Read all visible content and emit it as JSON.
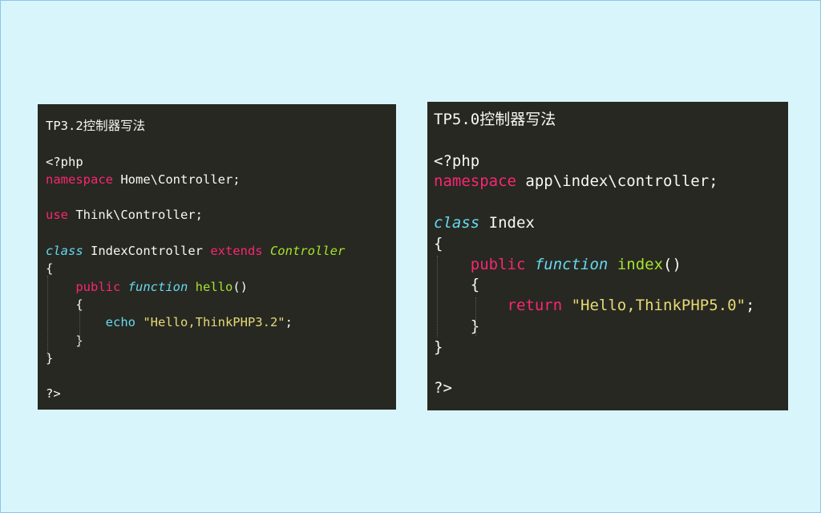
{
  "left": {
    "title": "TP3.2控制器写法",
    "php_open": "<?php",
    "ns_kw": "namespace",
    "ns_val": " Home\\Controller;",
    "use_kw": "use",
    "use_val": " Think\\Controller;",
    "class_kw": "class",
    "class_name": " IndexController ",
    "extends_kw": "extends",
    "parent": " Controller",
    "brace_open": "{",
    "public_kw": "public",
    "function_kw": "function",
    "method": "hello",
    "parens": "()",
    "inner_open": "{",
    "echo_kw": "echo",
    "string": "\"Hello,ThinkPHP3.2\"",
    "semicolon": ";",
    "inner_close": "}",
    "brace_close": "}",
    "php_close": "?>"
  },
  "right": {
    "title": "TP5.0控制器写法",
    "php_open": "<?php",
    "ns_kw": "namespace",
    "ns_val": " app\\index\\controller;",
    "class_kw": "class",
    "class_name": " Index",
    "brace_open": "{",
    "public_kw": "public",
    "function_kw": "function",
    "method": "index",
    "parens": "()",
    "inner_open": "{",
    "return_kw": "return",
    "string": "\"Hello,ThinkPHP5.0\"",
    "semicolon": ";",
    "inner_close": "}",
    "brace_close": "}",
    "php_close": "?>"
  },
  "colors": {
    "background": "#d9f5fc",
    "editor_bg": "#272822",
    "keyword": "#f92672",
    "storage": "#66d9ef",
    "function_name": "#a6e22e",
    "string": "#e6db74",
    "text": "#f8f8f2"
  }
}
